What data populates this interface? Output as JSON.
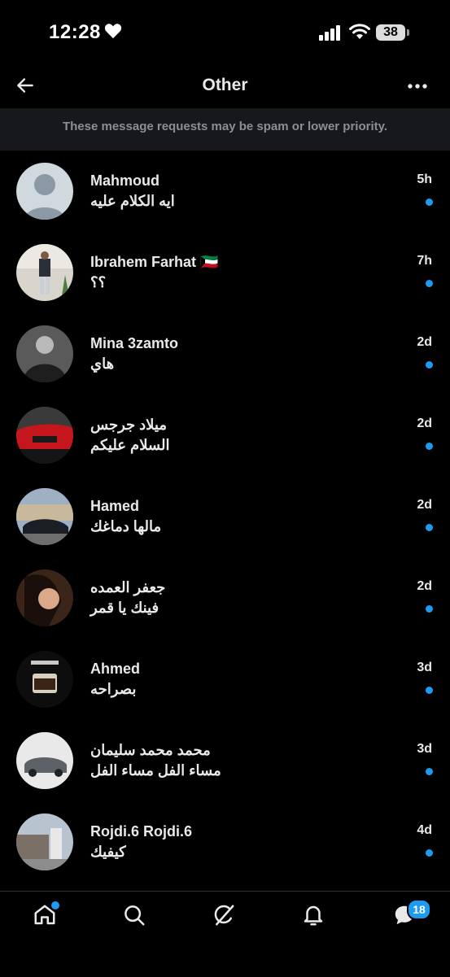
{
  "status_bar": {
    "time": "12:28",
    "battery": "38"
  },
  "header": {
    "title": "Other"
  },
  "banner": {
    "text": "These message requests may be spam or lower priority."
  },
  "conversations": [
    {
      "name": "Mahmoud",
      "message": "ايه الكلام عليه",
      "time": "5h",
      "unread": true
    },
    {
      "name": "Ibrahem Farhat 🇰🇼",
      "message": "؟؟",
      "time": "7h",
      "unread": true
    },
    {
      "name": "Mina 3zamto",
      "message": "هاي",
      "time": "2d",
      "unread": true
    },
    {
      "name": "ميلاد جرجس",
      "message": "السلام عليكم",
      "time": "2d",
      "unread": true
    },
    {
      "name": "Hamed",
      "message": "مالها دماغك",
      "time": "2d",
      "unread": true
    },
    {
      "name": "جعفر العمده",
      "message": "فينك يا قمر",
      "time": "2d",
      "unread": true
    },
    {
      "name": "Ahmed",
      "message": "بصراحه",
      "time": "3d",
      "unread": true
    },
    {
      "name": "محمد محمد سليمان",
      "message": "مساء الفل مساء الفل",
      "time": "3d",
      "unread": true
    },
    {
      "name": "Rojdi.6 Rojdi.6",
      "message": "كيفيك",
      "time": "4d",
      "unread": true
    }
  ],
  "tab_bar": {
    "tabs": [
      "home-icon",
      "search-icon",
      "grok-icon",
      "notifications-icon",
      "messages-icon"
    ],
    "messages_badge": "18"
  },
  "colors": {
    "accent": "#1d9bf0",
    "banner_bg": "#16181c"
  }
}
